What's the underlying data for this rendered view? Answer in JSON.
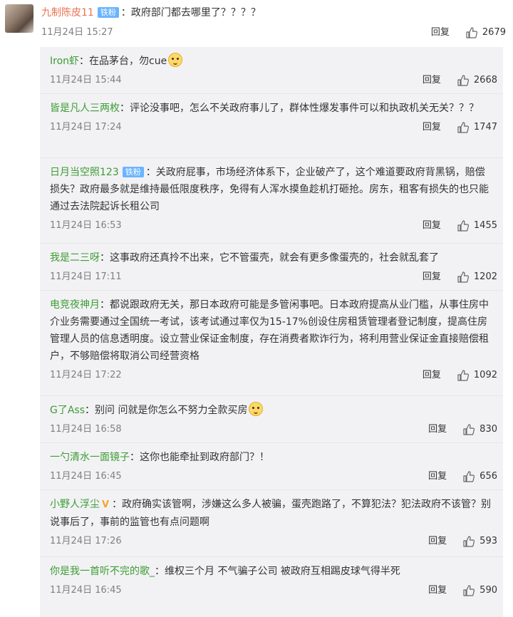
{
  "main": {
    "username": "九制陈皮11",
    "badge": "铁粉",
    "text": "：政府部门都去哪里了？？？？",
    "time": "11月24日 15:27",
    "reply_label": "回复",
    "likes": "2679"
  },
  "replies": [
    {
      "username": "Iron虾",
      "text": "：在品茅台，勿cue",
      "emoji": "doge-emoji",
      "time": "11月24日 15:44",
      "reply_label": "回复",
      "likes": "2668"
    },
    {
      "username": "皆是凡人三两枚",
      "text": "：评论没事吧，怎么不关政府事儿了，群体性爆发事件可以和执政机关无关？？？",
      "time": "11月24日 17:24",
      "reply_label": "回复",
      "likes": "1747"
    },
    {
      "username": "日月当空照123",
      "badge": "铁粉",
      "text": "：关政府屁事，市场经济体系下，企业破产了，这个难道要政府背黑锅，赔偿损失？政府最多就是维持最低限度秩序，免得有人浑水摸鱼趁机打砸抢。房东，租客有损失的也只能通过去法院起诉长租公司",
      "time": "11月24日 16:53",
      "reply_label": "回复",
      "likes": "1455"
    },
    {
      "username": "我是二三呀",
      "text": "：这事政府还真拎不出来，它不管蛋壳，就会有更多像蛋壳的，社会就乱套了",
      "time": "11月24日 17:11",
      "reply_label": "回复",
      "likes": "1202"
    },
    {
      "username": "电竞夜神月",
      "text": "：都说跟政府无关，那日本政府可能是多管闲事吧。日本政府提高从业门槛，从事住房中介业务需要通过全国统一考试，该考试通过率仅为15-17%创设住房租赁管理者登记制度，提高住房管理人员的信息透明度。设立营业保证金制度，存在消费者欺诈行为，将利用营业保证金直接赔偿租户，不够赔偿将取消公司经营资格",
      "time": "11月24日 17:22",
      "reply_label": "回复",
      "likes": "1092"
    },
    {
      "username": "G了Ass",
      "text": "：别问 问就是你怎么不努力全款买房",
      "emoji": "doge-emoji",
      "time": "11月24日 16:58",
      "reply_label": "回复",
      "likes": "830"
    },
    {
      "username": "一勺清水一面镜子",
      "text": "：这你也能牵扯到政府部门？！",
      "time": "11月24日 16:45",
      "reply_label": "回复",
      "likes": "656"
    },
    {
      "username": "小野人浮尘",
      "vbadge": "V",
      "text": "：政府确实该管啊，涉嫌这么多人被骗，蛋壳跑路了，不算犯法？犯法政府不该管？别说事后了，事前的监管也有点问题啊",
      "time": "11月24日 17:26",
      "reply_label": "回复",
      "likes": "593"
    },
    {
      "username": "你是我一首听不完的歌_",
      "text": "：维权三个月 不气骗子公司 被政府互相踢皮球气得半死",
      "time": "11月24日 16:45",
      "reply_label": "回复",
      "likes": "590"
    }
  ]
}
